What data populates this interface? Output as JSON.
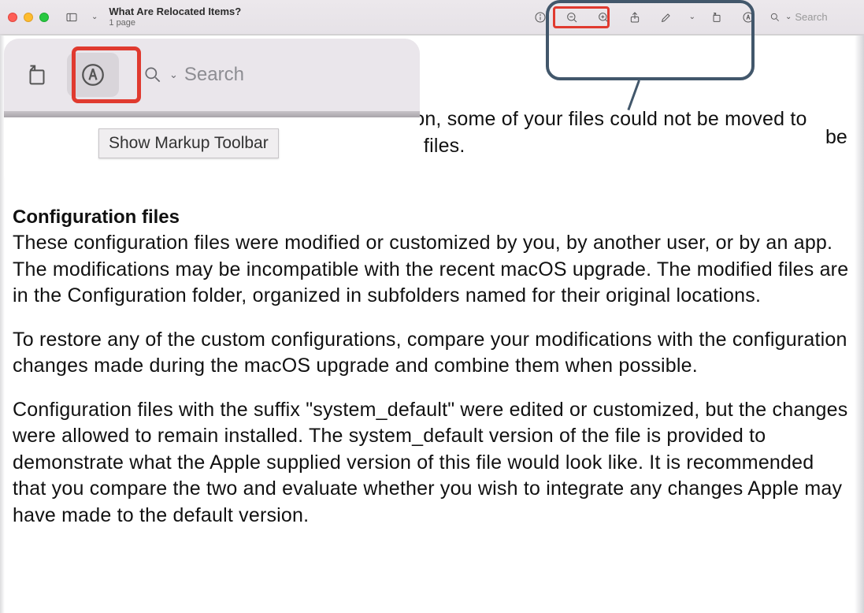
{
  "window": {
    "title": "What Are Relocated Items?",
    "subtitle": "1 page"
  },
  "toolbar": {
    "search_placeholder": "Search",
    "tooltip": "Show Markup Toolbar"
  },
  "zoom": {
    "search_placeholder": "Search",
    "tooltip": "Show Markup Toolbar"
  },
  "document": {
    "p1": "During the last macOS upgrade or file migration, some of your files could not be moved to their new locations. This folder contains these files.",
    "h1": "Configuration files",
    "p2": "These configuration files were modified or customized by you, by another user, or by an app. The modifications may be incompatible with the recent macOS upgrade. The modified files are in the Configuration folder, organized in subfolders named for their original locations.",
    "p3": "To restore any of the custom configurations, compare your modifications with the configuration changes made during the macOS upgrade and combine them when possible.",
    "p4": "Configuration files with the suffix \"system_default\" were edited or customized, but the changes were allowed to remain installed. The system_default version of the file is provided to demonstrate what the Apple supplied version of this file would look like. It is recommended that you compare the two and evaluate whether you wish to integrate any changes Apple may have made to the default version.",
    "be": "be"
  }
}
